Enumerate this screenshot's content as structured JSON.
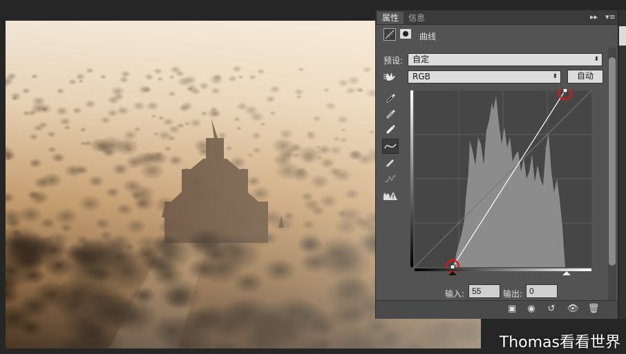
{
  "panel": {
    "tabs": [
      {
        "label": "属性",
        "active": true
      },
      {
        "label": "信息",
        "active": false
      }
    ],
    "collapse_glyph": "▸▸",
    "menu_glyph": "▾≡",
    "adjustment_title": "曲线",
    "preset_label": "预设:",
    "preset_value": "自定",
    "channel_value": "RGB",
    "auto_button": "自动",
    "input_label": "输入:",
    "input_value": "55",
    "output_label": "输出:",
    "output_value": "0",
    "tools": [
      "target-adjust-icon",
      "eyedropper-black-icon",
      "eyedropper-gray-icon",
      "eyedropper-white-icon",
      "curve-point-icon",
      "pencil-icon",
      "smooth-icon",
      "clipping-warning-icon"
    ],
    "bottom_icons": [
      "clip-to-layer-icon",
      "view-previous-icon",
      "reset-icon",
      "visibility-icon",
      "trash-icon"
    ]
  },
  "watermark": "Thomas看看世界",
  "colors": {
    "panel_bg": "#535353",
    "graph_bg": "#464646",
    "highlight_circle": "#e0141a"
  }
}
